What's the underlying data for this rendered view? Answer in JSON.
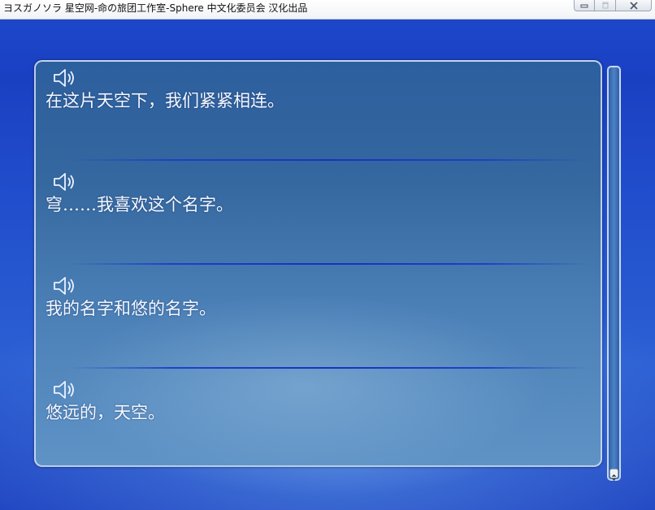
{
  "window": {
    "title": "ヨスガノソラ 星空网-命の旅团工作室-Sphere 中文化委员会 汉化出品"
  },
  "icons": {
    "minimize": "minimize-icon",
    "maximize": "maximize-icon",
    "close": "close-icon",
    "voice": "speaker-icon",
    "scroll": "scroll-arrows-icon"
  },
  "backlog": {
    "entries": [
      {
        "text": "在这片天空下，我们紧紧相连。"
      },
      {
        "text": "穹……我喜欢这个名字。"
      },
      {
        "text": "我的名字和悠的名字。"
      },
      {
        "text": "悠远的，天空。"
      }
    ]
  },
  "colors": {
    "background": "#1a3ec4",
    "panel": "#35689f",
    "text": "#f4f8ff",
    "divider": "#1932be"
  }
}
